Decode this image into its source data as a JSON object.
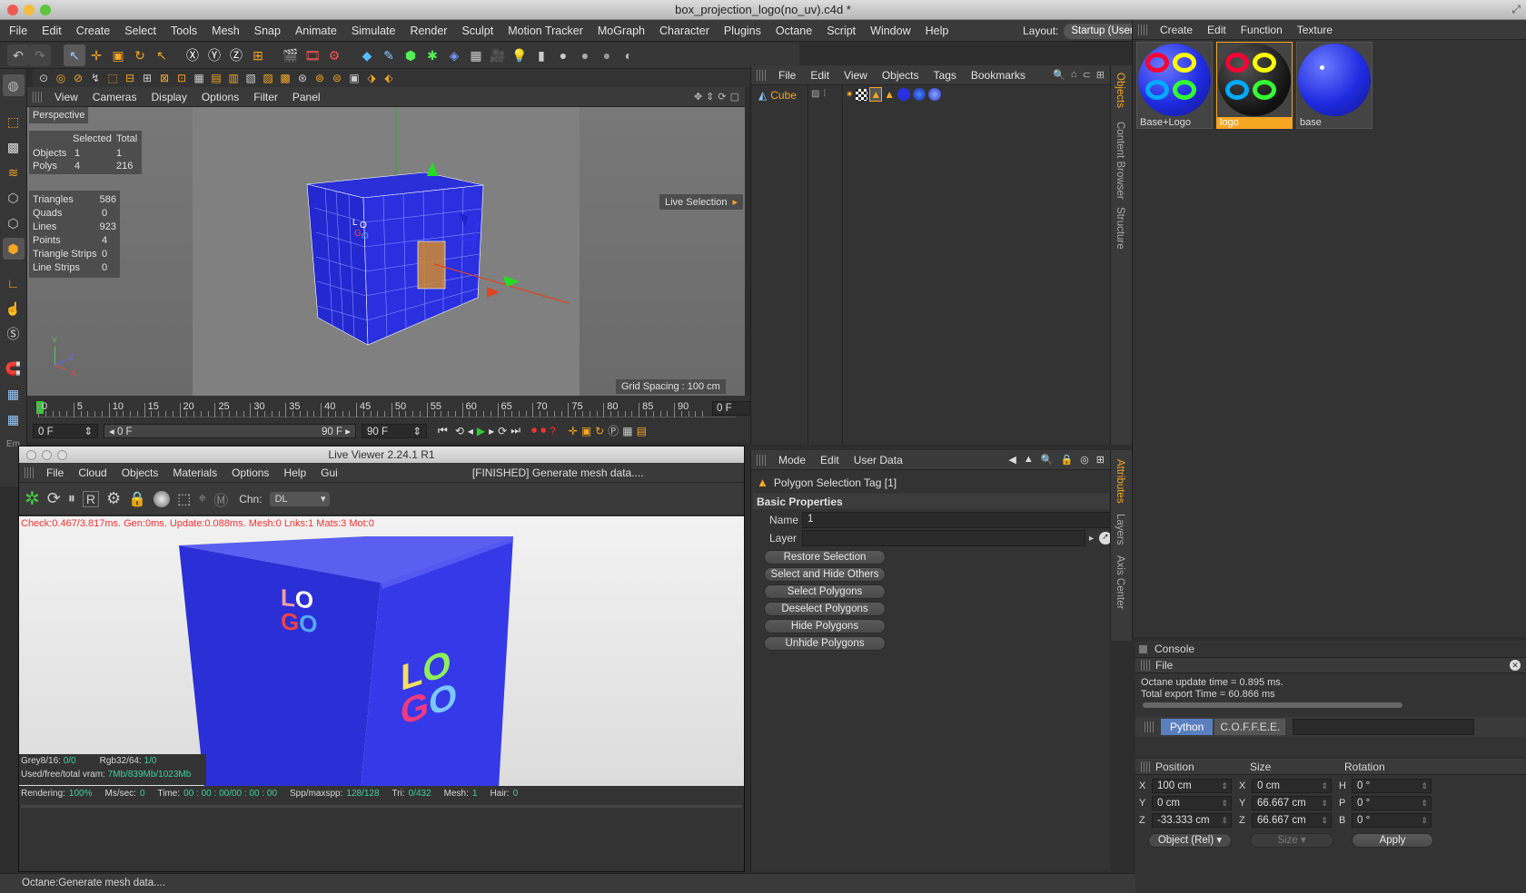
{
  "window": {
    "title": "box_projection_logo(no_uv).c4d *"
  },
  "menu": [
    "File",
    "Edit",
    "Create",
    "Select",
    "Tools",
    "Mesh",
    "Snap",
    "Animate",
    "Simulate",
    "Render",
    "Sculpt",
    "Motion Tracker",
    "MoGraph",
    "Character",
    "Plugins",
    "Octane",
    "Script",
    "Window",
    "Help"
  ],
  "layout": {
    "label": "Layout:",
    "value": "Startup (User)"
  },
  "viewport": {
    "menu": [
      "View",
      "Cameras",
      "Display",
      "Options",
      "Filter",
      "Panel"
    ],
    "camera": "Perspective",
    "stats_header": [
      "Selected",
      "Total"
    ],
    "stats": [
      {
        "k": "Objects",
        "s": "1",
        "t": "1"
      },
      {
        "k": "Polys",
        "s": "4",
        "t": "216"
      }
    ],
    "geo": [
      {
        "k": "Triangles",
        "v": "586"
      },
      {
        "k": "Quads",
        "v": "0"
      },
      {
        "k": "Lines",
        "v": "923"
      },
      {
        "k": "Points",
        "v": "4"
      },
      {
        "k": "Triangle Strips",
        "v": "0"
      },
      {
        "k": "Line Strips",
        "v": "0"
      }
    ],
    "tool": "Live Selection",
    "grid": "Grid Spacing : 100 cm",
    "axes": {
      "y": "Y",
      "z": "Z",
      "x": "X"
    }
  },
  "timeline": {
    "ticks": [
      "0",
      "5",
      "10",
      "15",
      "20",
      "25",
      "30",
      "35",
      "40",
      "45",
      "50",
      "55",
      "60",
      "65",
      "70",
      "75",
      "80",
      "85",
      "90"
    ],
    "frame": "0 F",
    "start": "0 F",
    "range_start": "0 F",
    "range_end": "90 F",
    "end": "90 F"
  },
  "objects_panel": {
    "menu": [
      "File",
      "Edit",
      "View",
      "Objects",
      "Tags",
      "Bookmarks"
    ],
    "object": "Cube"
  },
  "right_tabs": [
    "Objects",
    "Content Browser",
    "Structure"
  ],
  "attr_tabs": [
    "Attributes",
    "Layers",
    "Axis Center"
  ],
  "material_panel": {
    "menu": [
      "Create",
      "Edit",
      "Function",
      "Texture"
    ],
    "materials": [
      {
        "name": "Base+Logo",
        "selected": false
      },
      {
        "name": "logo",
        "selected": true
      },
      {
        "name": "base",
        "selected": false
      }
    ]
  },
  "attributes": {
    "menu": [
      "Mode",
      "Edit",
      "User Data"
    ],
    "title": "Polygon Selection Tag [1]",
    "section": "Basic Properties",
    "name_label": "Name",
    "name_value": "1",
    "layer_label": "Layer",
    "buttons": [
      "Restore Selection",
      "Select and Hide Others",
      "Select Polygons",
      "Deselect Polygons",
      "Hide Polygons",
      "Unhide Polygons"
    ]
  },
  "console": {
    "title": "Console",
    "file": "File",
    "lines": [
      "Octane update time = 0.895 ms.",
      "Total export Time = 60.866 ms"
    ],
    "tabs": [
      "Python",
      "C.O.F.F.E.E."
    ]
  },
  "coords": {
    "headers": [
      "Position",
      "Size",
      "Rotation"
    ],
    "rows": [
      {
        "a": "X",
        "p": "100 cm",
        "b": "X",
        "s": "0 cm",
        "c": "H",
        "r": "0 °"
      },
      {
        "a": "Y",
        "p": "0 cm",
        "b": "Y",
        "s": "66.667 cm",
        "c": "P",
        "r": "0 °"
      },
      {
        "a": "Z",
        "p": "-33.333 cm",
        "b": "Z",
        "s": "66.667 cm",
        "c": "B",
        "r": "0 °"
      }
    ],
    "mode": "Object (Rel)",
    "size_mode": "Size",
    "apply": "Apply"
  },
  "live_viewer": {
    "title": "Live Viewer 2.24.1 R1",
    "menu": [
      "File",
      "Cloud",
      "Objects",
      "Materials",
      "Options",
      "Help",
      "Gui"
    ],
    "status": "[FINISHED] Generate mesh data....",
    "chn_label": "Chn:",
    "chn_value": "DL",
    "debug": "Check:0.467/3.817ms. Gen:0ms. Update:0.088ms. Mesh:0 Lnks:1 Mats:3 Mot:0",
    "logo_top": [
      "L",
      "O"
    ],
    "logo_bot": [
      "G",
      "O"
    ],
    "mem1": {
      "g_l": "Grey8/16:",
      "g_v": "0/0",
      "r_l": "Rgb32/64:",
      "r_v": "1/0"
    },
    "mem2": {
      "l": "Used/free/total vram:",
      "v": "7Mb/839Mb/1023Mb"
    },
    "render": [
      {
        "k": "Rendering:",
        "v": "100%"
      },
      {
        "k": "Ms/sec:",
        "v": "0"
      },
      {
        "k": "Time:",
        "v": "00 : 00 : 00/00 : 00 : 00"
      },
      {
        "k": "Spp/maxspp:",
        "v": "128/128"
      },
      {
        "k": "Tri:",
        "v": "0/432"
      },
      {
        "k": "Mesh:",
        "v": "1"
      },
      {
        "k": "Hair:",
        "v": "0"
      }
    ]
  },
  "left_tabs": [
    "Em"
  ],
  "statusbar": "Octane:Generate mesh data....",
  "colors": {
    "accent": "#f0a020",
    "cube_blue": "#2a2fe0",
    "red_text": "#ff3030",
    "green_text": "#40d0a0"
  }
}
